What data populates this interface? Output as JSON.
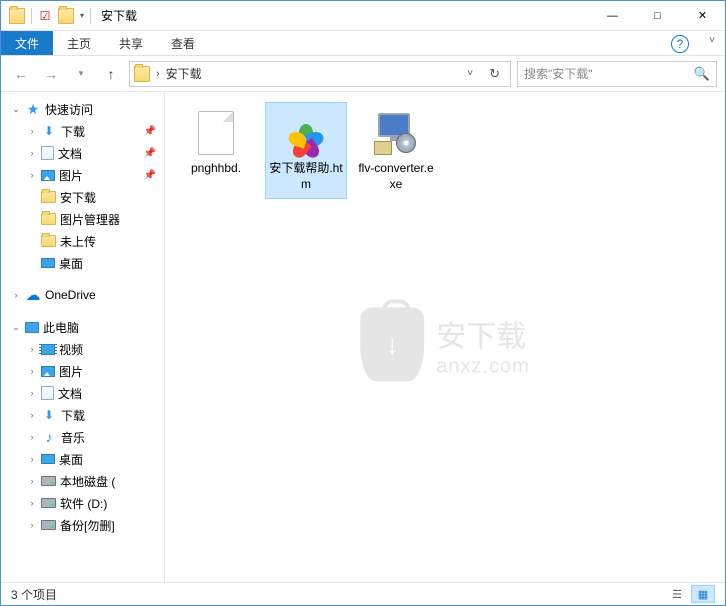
{
  "window": {
    "title": "安下载",
    "minimize": "—",
    "maximize": "□",
    "close": "✕"
  },
  "ribbon": {
    "file": "文件",
    "home": "主页",
    "share": "共享",
    "view": "查看"
  },
  "address": {
    "path": "安下载",
    "separator": "›",
    "search_placeholder": "搜索\"安下载\""
  },
  "sidebar": {
    "quick_access": "快速访问",
    "downloads": "下载",
    "documents": "文档",
    "pictures": "图片",
    "anxz": "安下载",
    "pic_manager": "图片管理器",
    "not_uploaded": "未上传",
    "desktop": "桌面",
    "onedrive": "OneDrive",
    "this_pc": "此电脑",
    "videos": "视频",
    "pictures2": "图片",
    "documents2": "文档",
    "downloads2": "下载",
    "music": "音乐",
    "desktop2": "桌面",
    "local_disk": "本地磁盘 (",
    "software_d": "软件 (D:)",
    "backup": "备份[勿删]"
  },
  "files": {
    "item1": "pnghhbd.",
    "item2": "安下载帮助.htm",
    "item3": "flv-converter.exe"
  },
  "watermark": {
    "brand": "安下载",
    "domain": "anxz.com"
  },
  "status": {
    "count": "3 个项目"
  }
}
